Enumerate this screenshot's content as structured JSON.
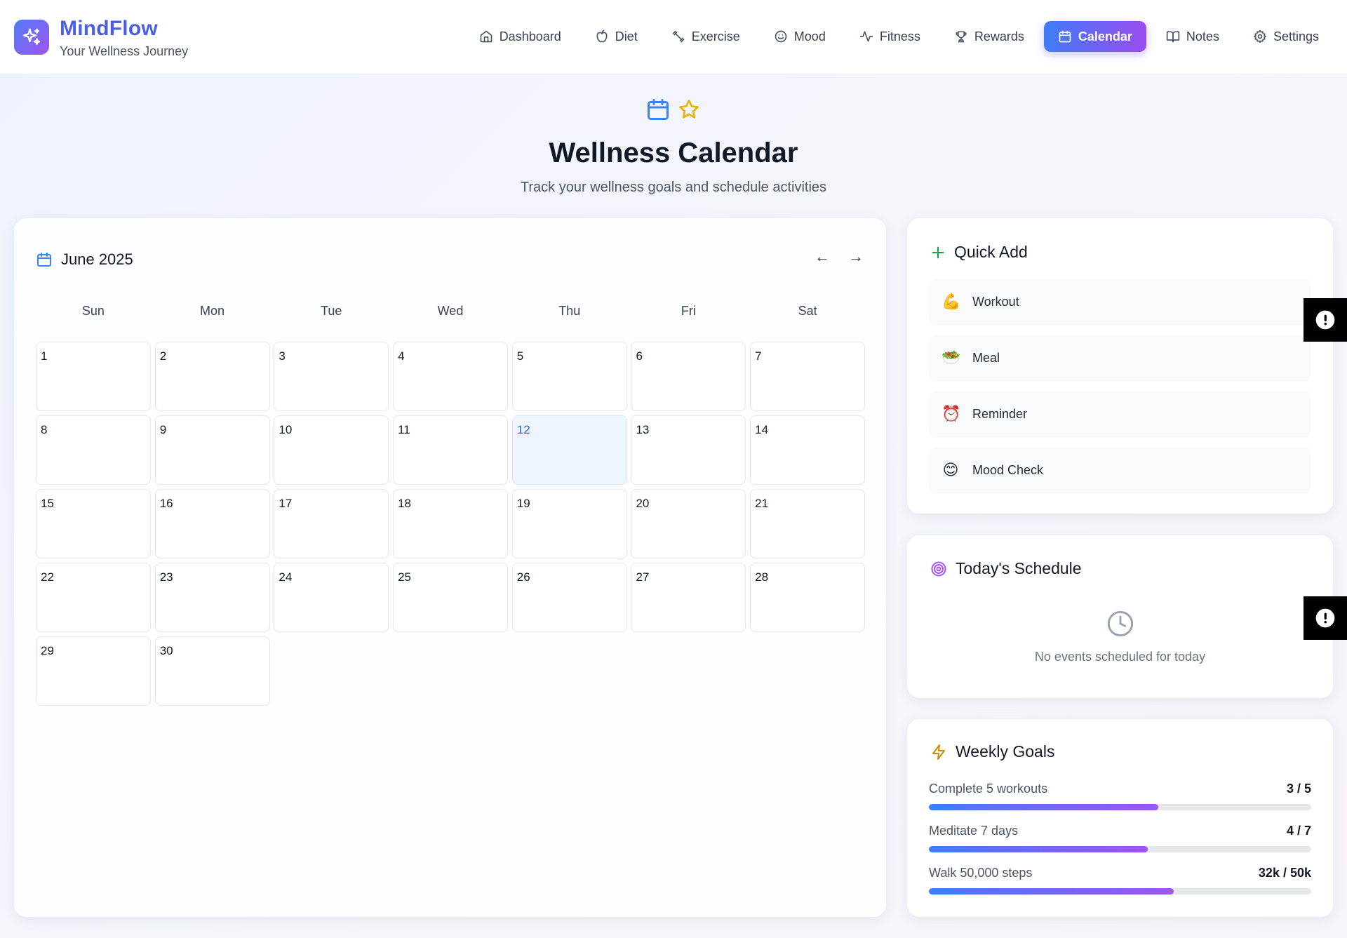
{
  "brand": {
    "name": "MindFlow",
    "tagline": "Your Wellness Journey"
  },
  "nav": [
    {
      "label": "Dashboard",
      "icon": "home-icon"
    },
    {
      "label": "Diet",
      "icon": "apple-icon"
    },
    {
      "label": "Exercise",
      "icon": "dumbbell-icon"
    },
    {
      "label": "Mood",
      "icon": "smile-icon"
    },
    {
      "label": "Fitness",
      "icon": "activity-icon"
    },
    {
      "label": "Rewards",
      "icon": "trophy-icon"
    },
    {
      "label": "Calendar",
      "icon": "calendar-icon",
      "active": true
    },
    {
      "label": "Notes",
      "icon": "book-icon"
    },
    {
      "label": "Settings",
      "icon": "gear-icon"
    }
  ],
  "hero": {
    "title": "Wellness Calendar",
    "subtitle": "Track your wellness goals and schedule activities"
  },
  "calendar": {
    "month_label": "June 2025",
    "prev": "←",
    "next": "→",
    "weekdays": [
      "Sun",
      "Mon",
      "Tue",
      "Wed",
      "Thu",
      "Fri",
      "Sat"
    ],
    "days": [
      "1",
      "2",
      "3",
      "4",
      "5",
      "6",
      "7",
      "8",
      "9",
      "10",
      "11",
      "12",
      "13",
      "14",
      "15",
      "16",
      "17",
      "18",
      "19",
      "20",
      "21",
      "22",
      "23",
      "24",
      "25",
      "26",
      "27",
      "28",
      "29",
      "30"
    ],
    "today": "12"
  },
  "quick_add": {
    "title": "Quick Add",
    "items": [
      {
        "emoji": "💪",
        "label": "Workout"
      },
      {
        "emoji": "🥗",
        "label": "Meal"
      },
      {
        "emoji": "⏰",
        "label": "Reminder"
      },
      {
        "emoji": "😊",
        "label": "Mood Check"
      }
    ]
  },
  "schedule": {
    "title": "Today's Schedule",
    "empty_text": "No events scheduled for today"
  },
  "goals": {
    "title": "Weekly Goals",
    "items": [
      {
        "label": "Complete 5 workouts",
        "value": "3 / 5",
        "progress": 0.6
      },
      {
        "label": "Meditate 7 days",
        "value": "4 / 7",
        "progress": 0.572
      },
      {
        "label": "Walk 50,000 steps",
        "value": "32k / 50k",
        "progress": 0.64
      }
    ]
  },
  "colors": {
    "accent_start": "#3f7cf6",
    "accent_end": "#9b4cf0",
    "today_bg": "#eef5ff",
    "today_text": "#2563eb"
  }
}
